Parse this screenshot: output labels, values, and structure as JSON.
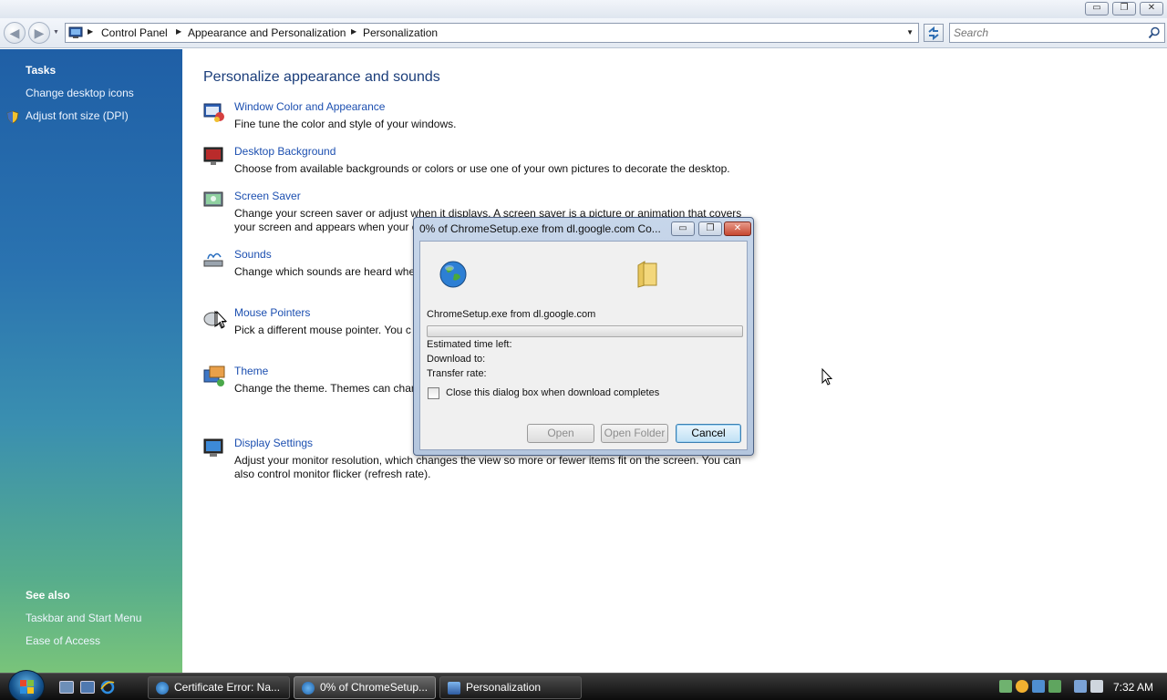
{
  "window": {
    "controls": {
      "minimize": "▭",
      "maximize": "❐",
      "close": "✕"
    }
  },
  "address": {
    "crumbs": [
      "Control Panel",
      "Appearance and Personalization",
      "Personalization"
    ],
    "search_placeholder": "Search"
  },
  "sidebar": {
    "tasks_heading": "Tasks",
    "tasks": [
      "Change desktop icons",
      "Adjust font size (DPI)"
    ],
    "see_also_heading": "See also",
    "see_also": [
      "Taskbar and Start Menu",
      "Ease of Access"
    ]
  },
  "main": {
    "title": "Personalize appearance and sounds",
    "items": [
      {
        "title": "Window Color and Appearance",
        "desc": "Fine tune the color and style of your windows.",
        "icon": "window-color-icon"
      },
      {
        "title": "Desktop Background",
        "desc": "Choose from available backgrounds or colors or use one of your own pictures to decorate the desktop.",
        "icon": "desktop-background-icon"
      },
      {
        "title": "Screen Saver",
        "desc": "Change your screen saver or adjust when it displays. A screen saver is a picture or animation that covers your screen and appears when your c",
        "icon": "screen-saver-icon"
      },
      {
        "title": "Sounds",
        "desc": "Change which sounds are heard when Bin.",
        "icon": "sounds-icon"
      },
      {
        "title": "Mouse Pointers",
        "desc": "Pick a different mouse pointer. You c as clicking and selecting.",
        "icon": "mouse-pointer-icon"
      },
      {
        "title": "Theme",
        "desc": "Change the theme. Themes can chan including the appearance of menus, i mouse pointers.",
        "icon": "theme-icon"
      },
      {
        "title": "Display Settings",
        "desc": "Adjust your monitor resolution, which changes the view so more or fewer items fit on the screen. You can also control monitor flicker (refresh rate).",
        "icon": "display-settings-icon"
      }
    ]
  },
  "dialog": {
    "title": "0% of ChromeSetup.exe from dl.google.com Co...",
    "file_label": "ChromeSetup.exe from dl.google.com",
    "progress_fraction": 0.0,
    "estimated_label": "Estimated time left:",
    "download_to_label": "Download to:",
    "transfer_rate_label": "Transfer rate:",
    "close_checkbox_label": "Close this dialog box when download completes",
    "close_checkbox_checked": false,
    "buttons": {
      "open": "Open",
      "open_folder": "Open Folder",
      "cancel": "Cancel"
    }
  },
  "taskbar": {
    "tasks": [
      {
        "label": "Certificate Error: Na...",
        "active": false
      },
      {
        "label": "0% of ChromeSetup...",
        "active": true
      },
      {
        "label": "Personalization",
        "active": false
      }
    ],
    "clock": "7:32 AM"
  },
  "colors": {
    "link": "#1c4fb0",
    "title": "#1a3d7a",
    "sidebar_top": "#1f5fa6",
    "sidebar_bottom": "#79c47a"
  }
}
